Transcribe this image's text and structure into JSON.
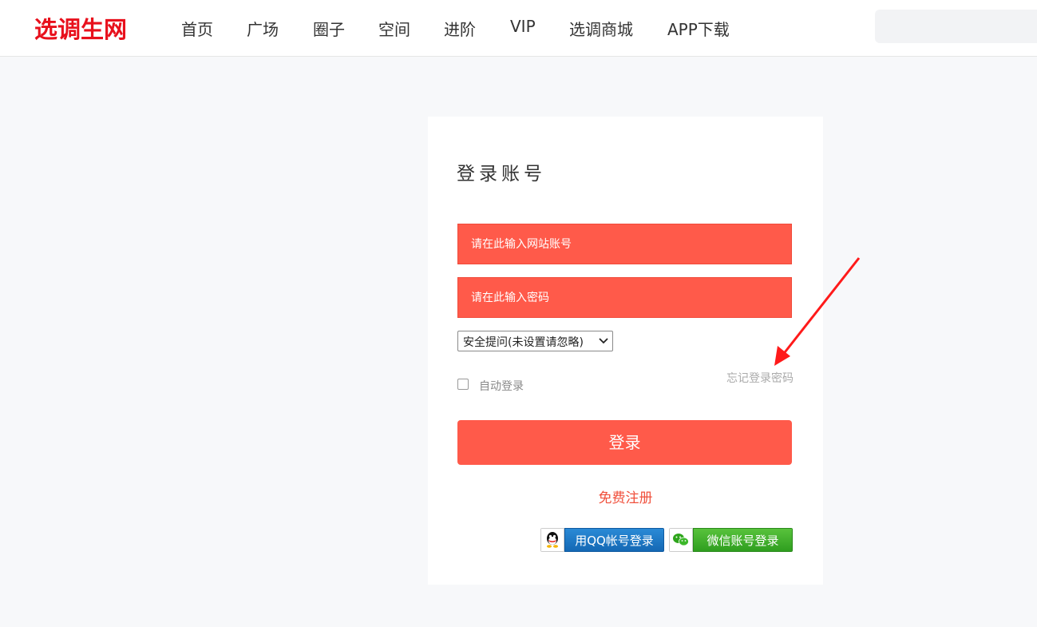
{
  "header": {
    "logo": "选调生网",
    "nav": [
      "首页",
      "广场",
      "圈子",
      "空间",
      "进阶",
      "VIP",
      "选调商城",
      "APP下载"
    ]
  },
  "login": {
    "title": "登录账号",
    "account_placeholder": "请在此输入网站账号",
    "password_placeholder": "请在此输入密码",
    "security_question": "安全提问(未设置请忽略)",
    "auto_login": "自动登录",
    "forgot_password": "忘记登录密码",
    "submit": "登录",
    "register": "免费注册",
    "qq_login": "用QQ帐号登录",
    "wechat_login": "微信账号登录"
  },
  "colors": {
    "brand": "#e8101c",
    "accent": "#ff5a4a",
    "annotation_arrow": "#ff1a1a"
  }
}
